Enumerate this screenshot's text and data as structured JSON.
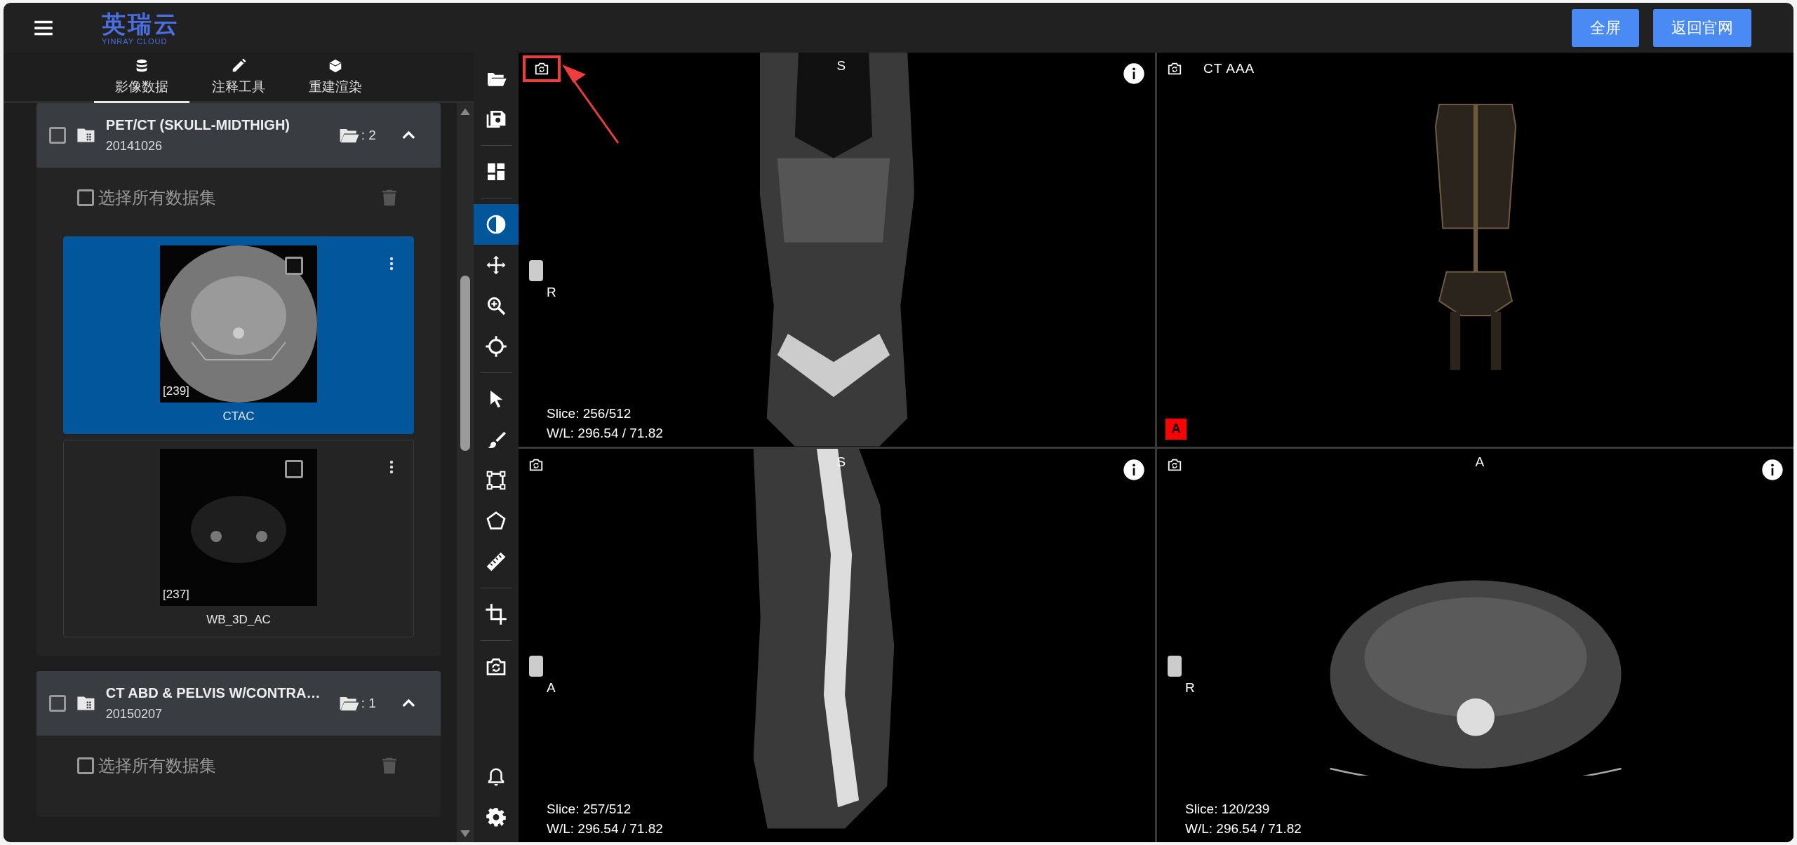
{
  "header": {
    "logo_name": "英瑞云",
    "logo_subtitle": "YINRAY CLOUD",
    "buttons": [
      "全屏",
      "返回官网"
    ]
  },
  "sidebar": {
    "tabs": [
      {
        "label": "影像数据",
        "selected": true
      },
      {
        "label": "注释工具",
        "selected": false
      },
      {
        "label": "重建渲染",
        "selected": false
      }
    ],
    "studies": [
      {
        "title": "PET/CT (SKULL-MIDTHIGH)",
        "date": "20141026",
        "count": ": 2",
        "checked": false,
        "expanded": true,
        "select_all": "选择所有数据集",
        "select_all_checked": false,
        "series": [
          {
            "name": "CTAC",
            "frames": "[239]",
            "kind": "ct",
            "selected": true,
            "checked": false
          },
          {
            "name": "WB_3D_AC",
            "frames": "[237]",
            "kind": "pet",
            "selected": false,
            "checked": false
          }
        ]
      },
      {
        "title": "CT ABD & PELVIS W/CONTRA…",
        "date": "20150207",
        "count": ": 1",
        "checked": false,
        "expanded": true,
        "select_all": "选择所有数据集",
        "select_all_checked": false
      }
    ]
  },
  "toolbar": {
    "groups": [
      [
        {
          "kind": "folder",
          "selected": false
        },
        {
          "kind": "save",
          "selected": false
        }
      ],
      [
        {
          "kind": "layout",
          "selected": false
        }
      ],
      [
        {
          "kind": "contrast",
          "selected": true
        },
        {
          "kind": "move",
          "selected": false
        },
        {
          "kind": "zoom",
          "selected": false
        },
        {
          "kind": "crosshair",
          "selected": false
        }
      ],
      [
        {
          "kind": "pointer",
          "selected": false
        },
        {
          "kind": "brush",
          "selected": false
        },
        {
          "kind": "bbox",
          "selected": false
        },
        {
          "kind": "pentagon",
          "selected": false
        },
        {
          "kind": "ruler",
          "selected": false
        }
      ],
      [
        {
          "kind": "crop",
          "selected": false
        }
      ],
      [
        {
          "kind": "camera",
          "selected": false
        }
      ]
    ],
    "bottom": [
      {
        "kind": "bell",
        "selected": false
      },
      {
        "kind": "gear",
        "selected": false
      }
    ]
  },
  "viewports": [
    {
      "kind": "slice",
      "top_label": "S",
      "side_label": "R",
      "level": 0.5,
      "info": true,
      "slice": "Slice: 256/512",
      "wl": "W/L: 296.54 / 71.82",
      "highlighted": true
    },
    {
      "kind": "volume",
      "title": "CT AAA",
      "badge": "A",
      "info": false,
      "highlighted": false
    },
    {
      "kind": "slice",
      "top_label": "S",
      "side_label": "A",
      "level": 0.5,
      "info": true,
      "slice": "Slice: 257/512",
      "wl": "W/L: 296.54 / 71.82",
      "highlighted": false
    },
    {
      "kind": "slice",
      "top_label": "A",
      "side_label": "R",
      "level": 0.5,
      "info": true,
      "slice": "Slice: 120/239",
      "wl": "W/L: 296.54 / 71.82",
      "highlighted": false
    }
  ]
}
